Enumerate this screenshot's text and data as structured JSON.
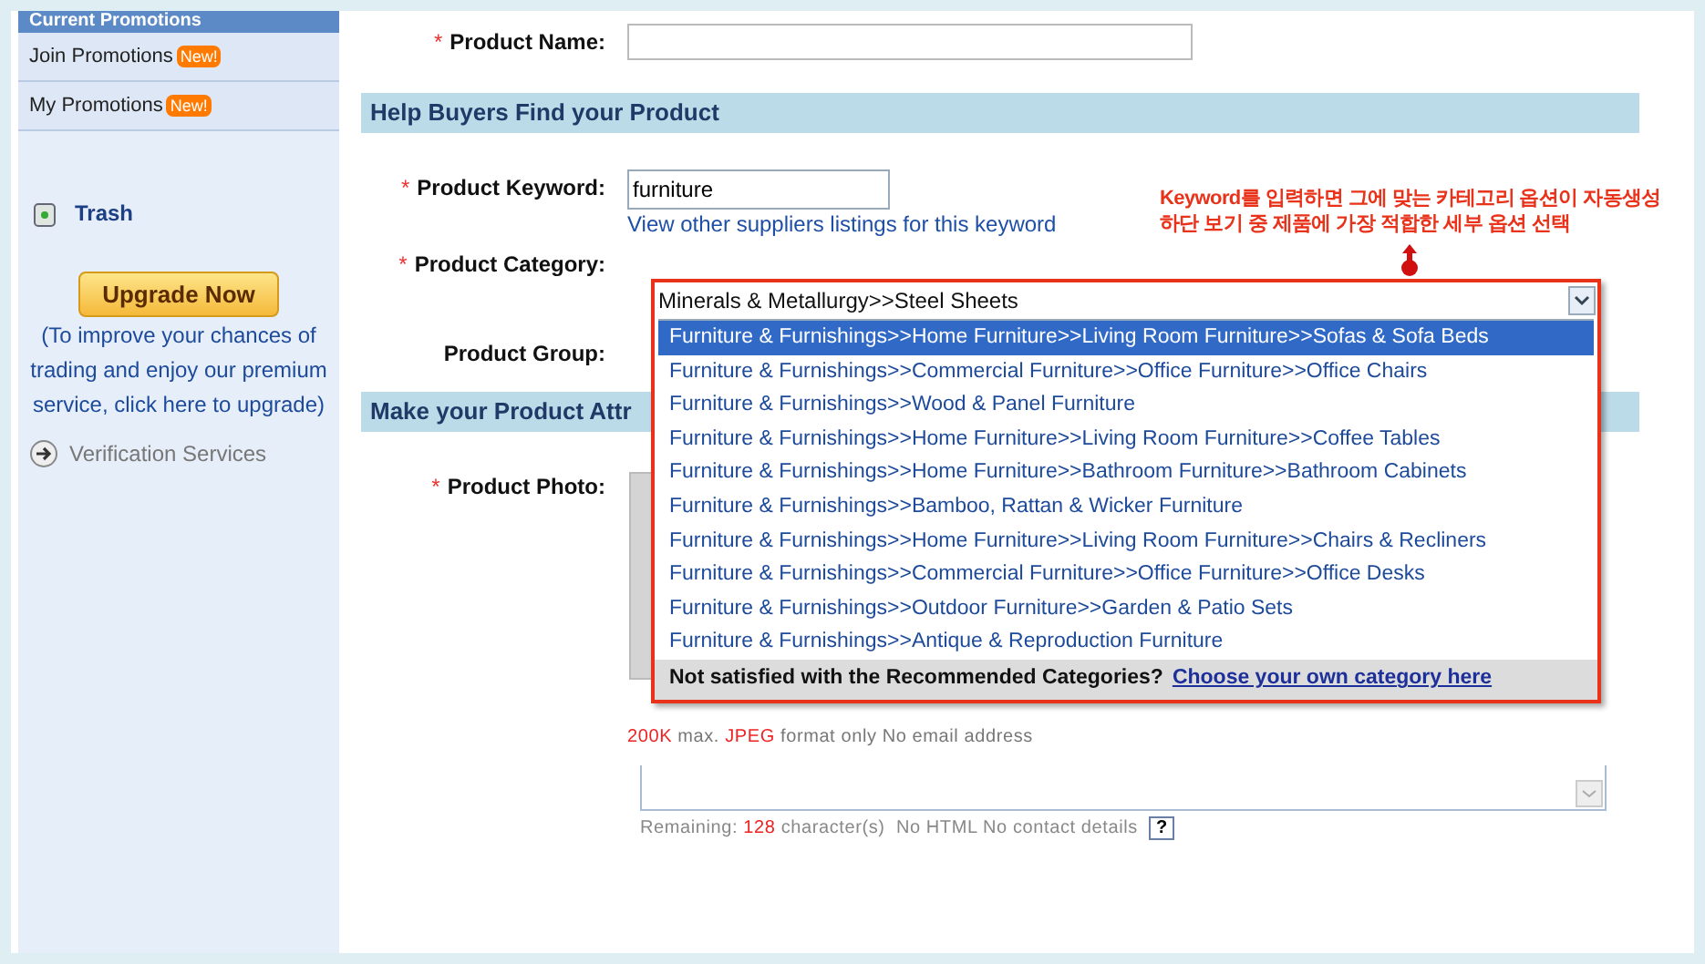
{
  "sidebar": {
    "header": "Current Promotions",
    "items": [
      {
        "label": "Join Promotions",
        "badge": "New!"
      },
      {
        "label": "My Promotions",
        "badge": "New!"
      }
    ],
    "trash": "Trash",
    "upgrade_button": "Upgrade Now",
    "upgrade_note": "(To improve your chances of trading and enjoy our premium service, click here to upgrade)",
    "verification": "Verification Services"
  },
  "form": {
    "product_name": {
      "label": "Product Name:",
      "marker": "*"
    },
    "section_1": "Help Buyers Find your Product",
    "product_keyword": {
      "label": "Product Keyword:",
      "marker": "*",
      "value": "furniture",
      "link": "View other suppliers listings for this keyword"
    },
    "product_category": {
      "label": "Product Category:",
      "marker": "*",
      "value": "Minerals & Metallurgy>>Steel Sheets",
      "options": [
        {
          "label": "Furniture & Furnishings>>Home Furniture>>Living Room Furniture>>Sofas & Sofa Beds",
          "selected": true
        },
        {
          "label": "Furniture & Furnishings>>Commercial Furniture>>Office Furniture>>Office Chairs",
          "selected": false
        },
        {
          "label": "Furniture & Furnishings>>Wood & Panel Furniture",
          "selected": false
        },
        {
          "label": "Furniture & Furnishings>>Home Furniture>>Living Room Furniture>>Coffee Tables",
          "selected": false
        },
        {
          "label": "Furniture & Furnishings>>Home Furniture>>Bathroom Furniture>>Bathroom Cabinets",
          "selected": false
        },
        {
          "label": "Furniture & Furnishings>>Bamboo, Rattan & Wicker Furniture",
          "selected": false
        },
        {
          "label": "Furniture & Furnishings>>Home Furniture>>Living Room Furniture>>Chairs & Recliners",
          "selected": false
        },
        {
          "label": "Furniture & Furnishings>>Commercial Furniture>>Office Furniture>>Office Desks",
          "selected": false
        },
        {
          "label": "Furniture & Furnishings>>Outdoor Furniture>>Garden & Patio Sets",
          "selected": false
        },
        {
          "label": "Furniture & Furnishings>>Antique & Reproduction Furniture",
          "selected": false
        }
      ],
      "footer_text": "Not satisfied with the Recommended Categories?",
      "footer_link": "Choose your own category here"
    },
    "product_group": {
      "label": "Product Group:"
    },
    "section_2": "Make your Product Attr",
    "product_photo": {
      "label": "Product Photo:",
      "marker": "*"
    },
    "photo_hint": [
      {
        "text": "200K",
        "highlight": true
      },
      {
        "text": " max. ",
        "highlight": false
      },
      {
        "text": "JPEG",
        "highlight": true
      },
      {
        "text": " format only No email address",
        "highlight": false
      }
    ],
    "remaining": [
      {
        "text": "Remaining: ",
        "highlight": false
      },
      {
        "text": "128",
        "highlight": true
      },
      {
        "text": " character(s)  No HTML No contact details",
        "highlight": false
      }
    ],
    "help": "?"
  },
  "annotation": [
    "Keyword를 입력하면 그에 맞는 카테고리 옵션이 자동생성",
    "하단 보기 중 제품에 가장 적합한 세부 옵션 선택"
  ]
}
